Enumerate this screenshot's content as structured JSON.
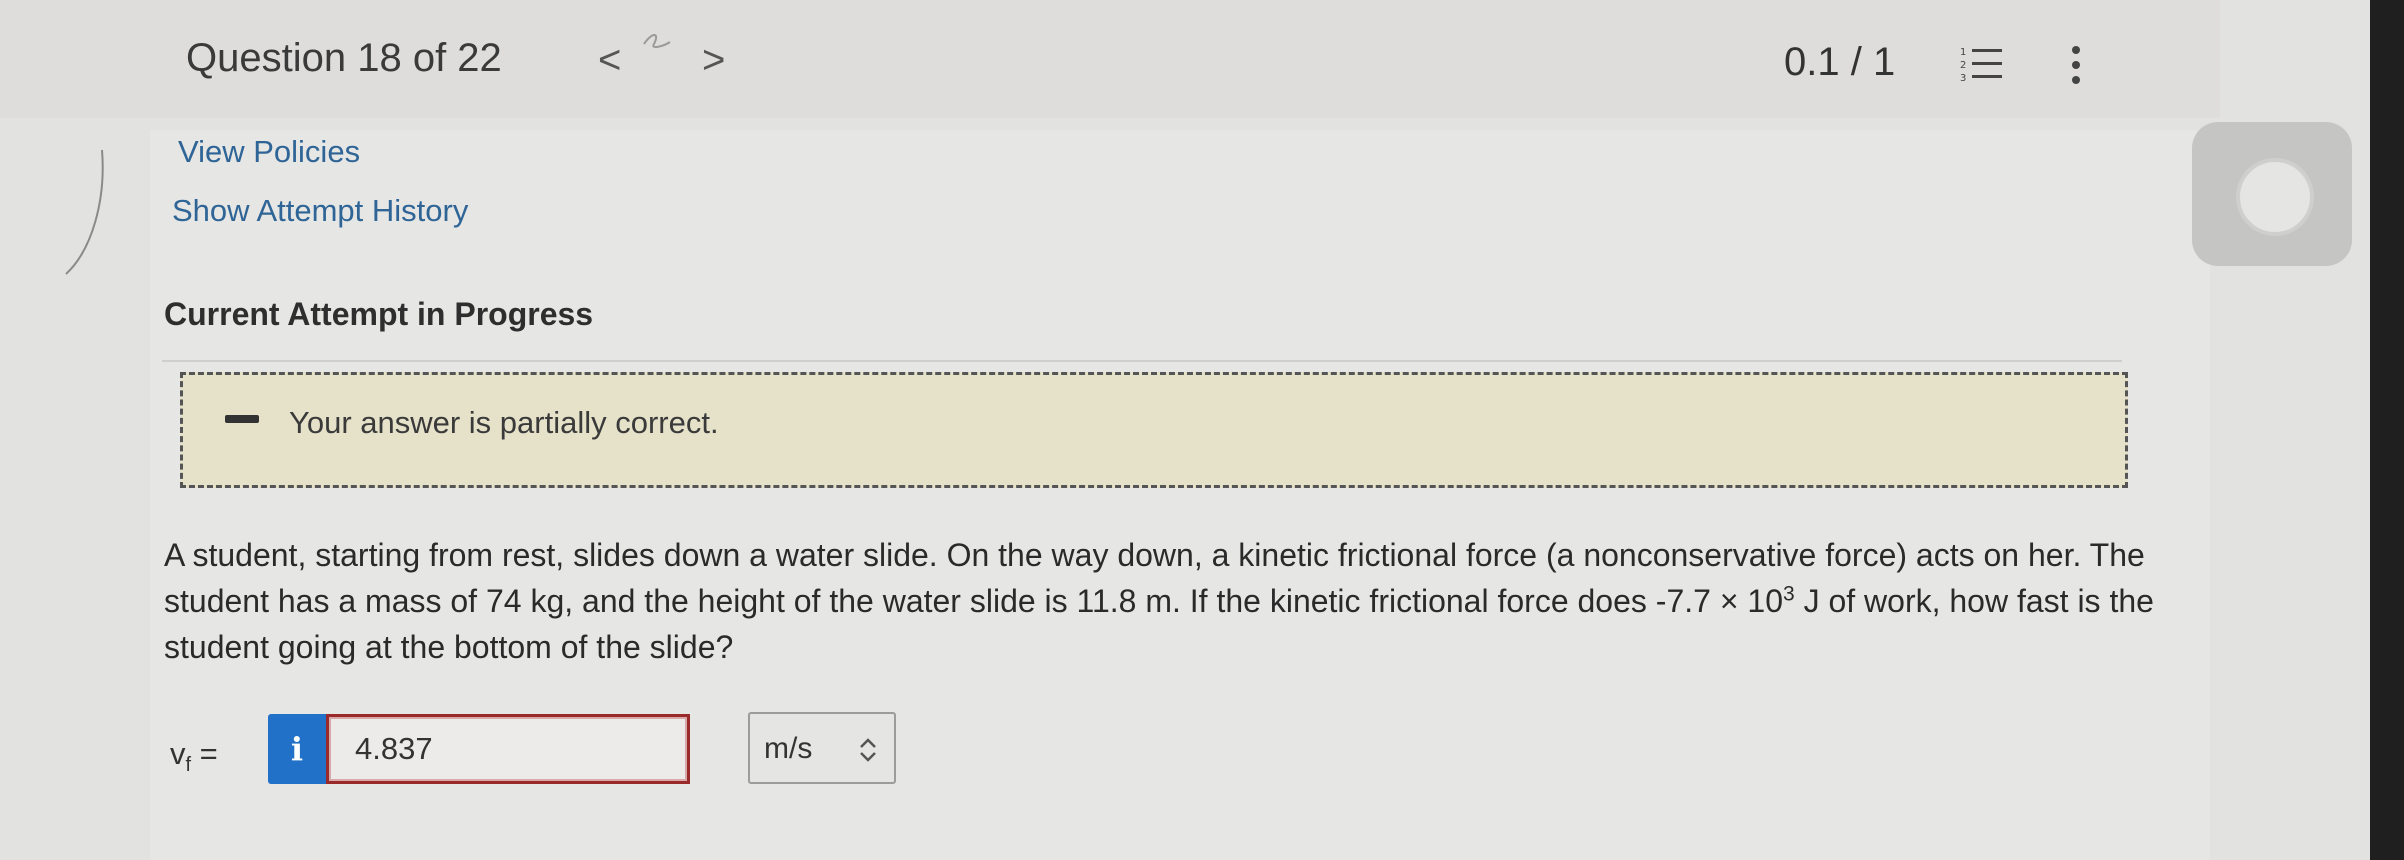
{
  "header": {
    "question_title": "Question 18 of 22",
    "prev_label": "<",
    "next_label": ">",
    "score": "0.1 / 1"
  },
  "links": {
    "view_policies": "View Policies",
    "attempt_history": "Show Attempt History"
  },
  "attempt": {
    "title": "Current Attempt in Progress",
    "feedback": "Your answer is partially correct."
  },
  "question": {
    "text_before_exp": "A student, starting from rest, slides down a water slide. On the way down, a kinetic frictional force (a nonconservative force) acts on her. The student has a mass of 74 kg, and the height of the water slide is 11.8 m. If the kinetic frictional force does -7.7 × 10",
    "exponent": "3",
    "text_after_exp": " J of work, how fast is the student going at the bottom of the slide?"
  },
  "answer": {
    "variable": "v",
    "subscript": "f",
    "equals": " =",
    "info_label": "i",
    "value": "4.837",
    "unit": "m/s"
  },
  "colors": {
    "link": "#2f6596",
    "feedback_bg": "#e5e2c9",
    "info_button": "#2271c9",
    "answer_border": "#9a2a2a"
  }
}
